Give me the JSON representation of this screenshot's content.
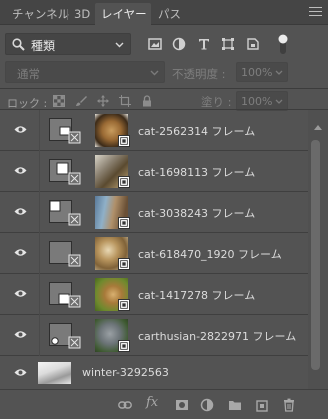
{
  "tabs": [
    {
      "label": "チャンネル",
      "active": false
    },
    {
      "label": "3D",
      "active": false
    },
    {
      "label": "レイヤー",
      "active": true
    },
    {
      "label": "パス",
      "active": false
    }
  ],
  "filter": {
    "kind_label": "種類",
    "icons": [
      "image-filter-icon",
      "adjustment-filter-icon",
      "type-filter-icon",
      "shape-filter-icon",
      "smart-object-filter-icon",
      "filter-toggle-icon"
    ]
  },
  "blend": {
    "mode": "通常",
    "opacity_label": "不透明度 :",
    "opacity_value": "100%"
  },
  "lock": {
    "label": "ロック :",
    "fill_label": "塗り :",
    "fill_value": "100%",
    "icons": [
      "lock-transparent-icon",
      "lock-paint-icon",
      "lock-move-icon",
      "lock-artboard-icon",
      "lock-all-icon"
    ]
  },
  "layers": [
    {
      "name": "cat-2562314 フレーム",
      "visible": true
    },
    {
      "name": "cat-1698113 フレーム",
      "visible": true
    },
    {
      "name": "cat-3038243 フレーム",
      "visible": true
    },
    {
      "name": "cat-618470_1920 フレーム",
      "visible": true
    },
    {
      "name": "cat-1417278 フレーム",
      "visible": true
    },
    {
      "name": "carthusian-2822971 フレーム",
      "visible": true
    },
    {
      "name": "winter-3292563",
      "visible": true
    }
  ],
  "footer": {
    "icons": [
      "link-layers-icon",
      "fx-icon",
      "add-mask-icon",
      "adjustment-layer-icon",
      "new-group-icon",
      "new-layer-icon",
      "delete-layer-icon"
    ],
    "fx_label": "fx"
  },
  "colors": {
    "panel_bg": "#535353",
    "tabbar_bg": "#454545",
    "text": "#dcdcdc",
    "dim_text": "#7e7e7e"
  }
}
